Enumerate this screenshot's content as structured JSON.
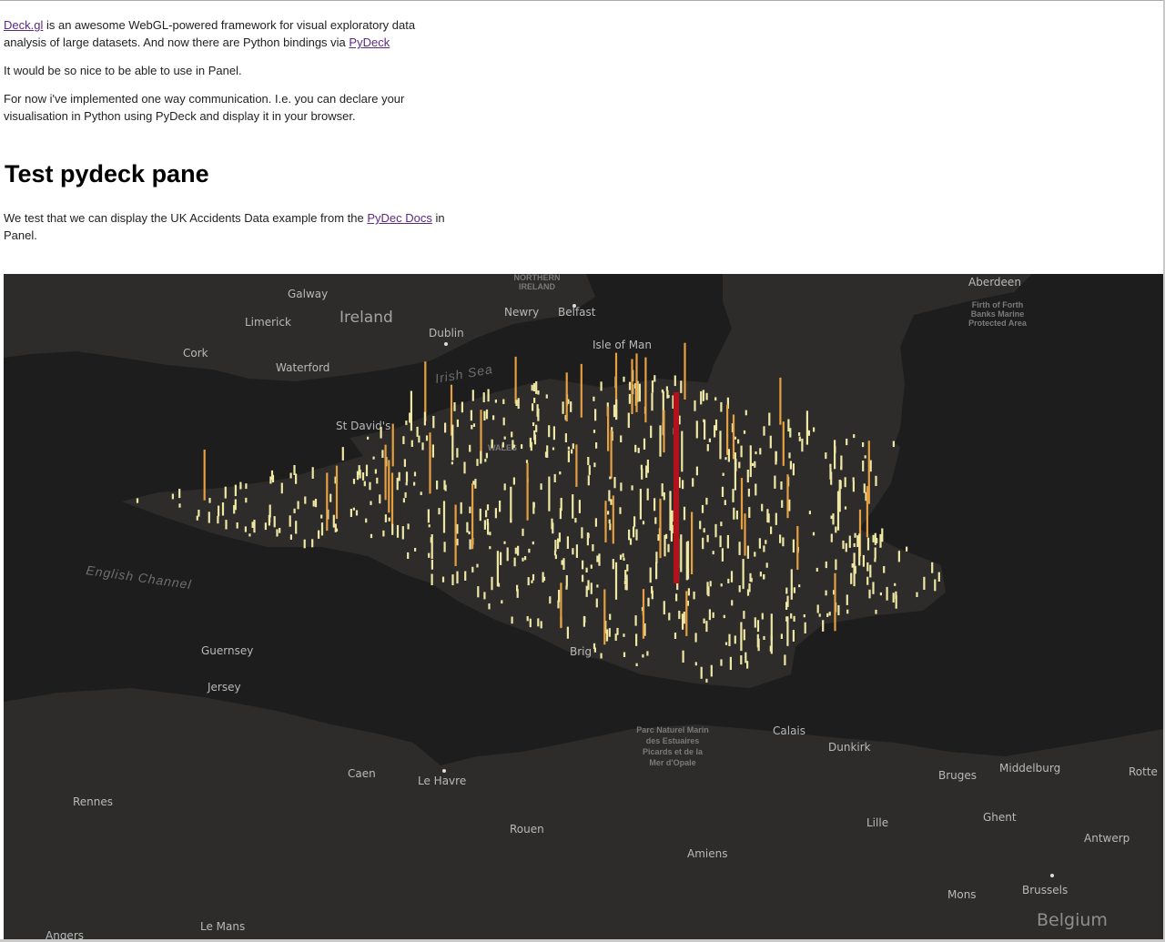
{
  "intro": {
    "p1_link1": "Deck.gl",
    "p1_text1": " is an awesome WebGL-powered framework for visual exploratory data analysis of large datasets. And now there are Python bindings via ",
    "p1_link2": "PyDeck",
    "p2": "It would be so nice to be able to use in Panel.",
    "p3": "For now i've implemented one way communication. I.e. you can declare your visualisation in Python using PyDeck and display it in your browser."
  },
  "section": {
    "title": "Test pydeck pane",
    "text1": "We test that we can display the UK Accidents Data example from the ",
    "link": "PyDec Docs",
    "text2": " in Panel."
  },
  "map": {
    "colors": {
      "water": "#1d1d1d",
      "land": "#2d2c2b",
      "column_low": "#efe8a4",
      "column_mid": "#e7a041",
      "column_high": "#b3121c"
    },
    "labels": {
      "northern_ireland": "NORTHERN\nIRELAND",
      "galway": "Galway",
      "ireland": "Ireland",
      "limerick": "Limerick",
      "dublin": "Dublin",
      "newry": "Newry",
      "belfast": "Belfast",
      "cork": "Cork",
      "waterford": "Waterford",
      "isle_of_man": "Isle of Man",
      "irish_sea": "Irish Sea",
      "st_davids": "St David's",
      "wales": "WALES",
      "english_channel": "English Channel",
      "guernsey": "Guernsey",
      "jersey": "Jersey",
      "parc_naturel": "Parc Naturel Marin\ndes Estuaires\nPicards et de la\nMer d'Opale",
      "calais": "Calais",
      "dunkirk": "Dunkirk",
      "caen": "Caen",
      "le_havre": "Le Havre",
      "rennes": "Rennes",
      "rouen": "Rouen",
      "amiens": "Amiens",
      "lille": "Lille",
      "bruges": "Bruges",
      "middelburg": "Middelburg",
      "rotte": "Rotte",
      "ghent": "Ghent",
      "antwerp": "Antwerp",
      "brussels": "Brussels",
      "belgium": "Belgium",
      "mons": "Mons",
      "le_mans": "Le Mans",
      "angers": "Angers",
      "brig": "Brig",
      "firth_of_forth": "Firth of Forth\nBanks Marine\nProtected Area",
      "aberdeen": "Aberdeen"
    }
  }
}
